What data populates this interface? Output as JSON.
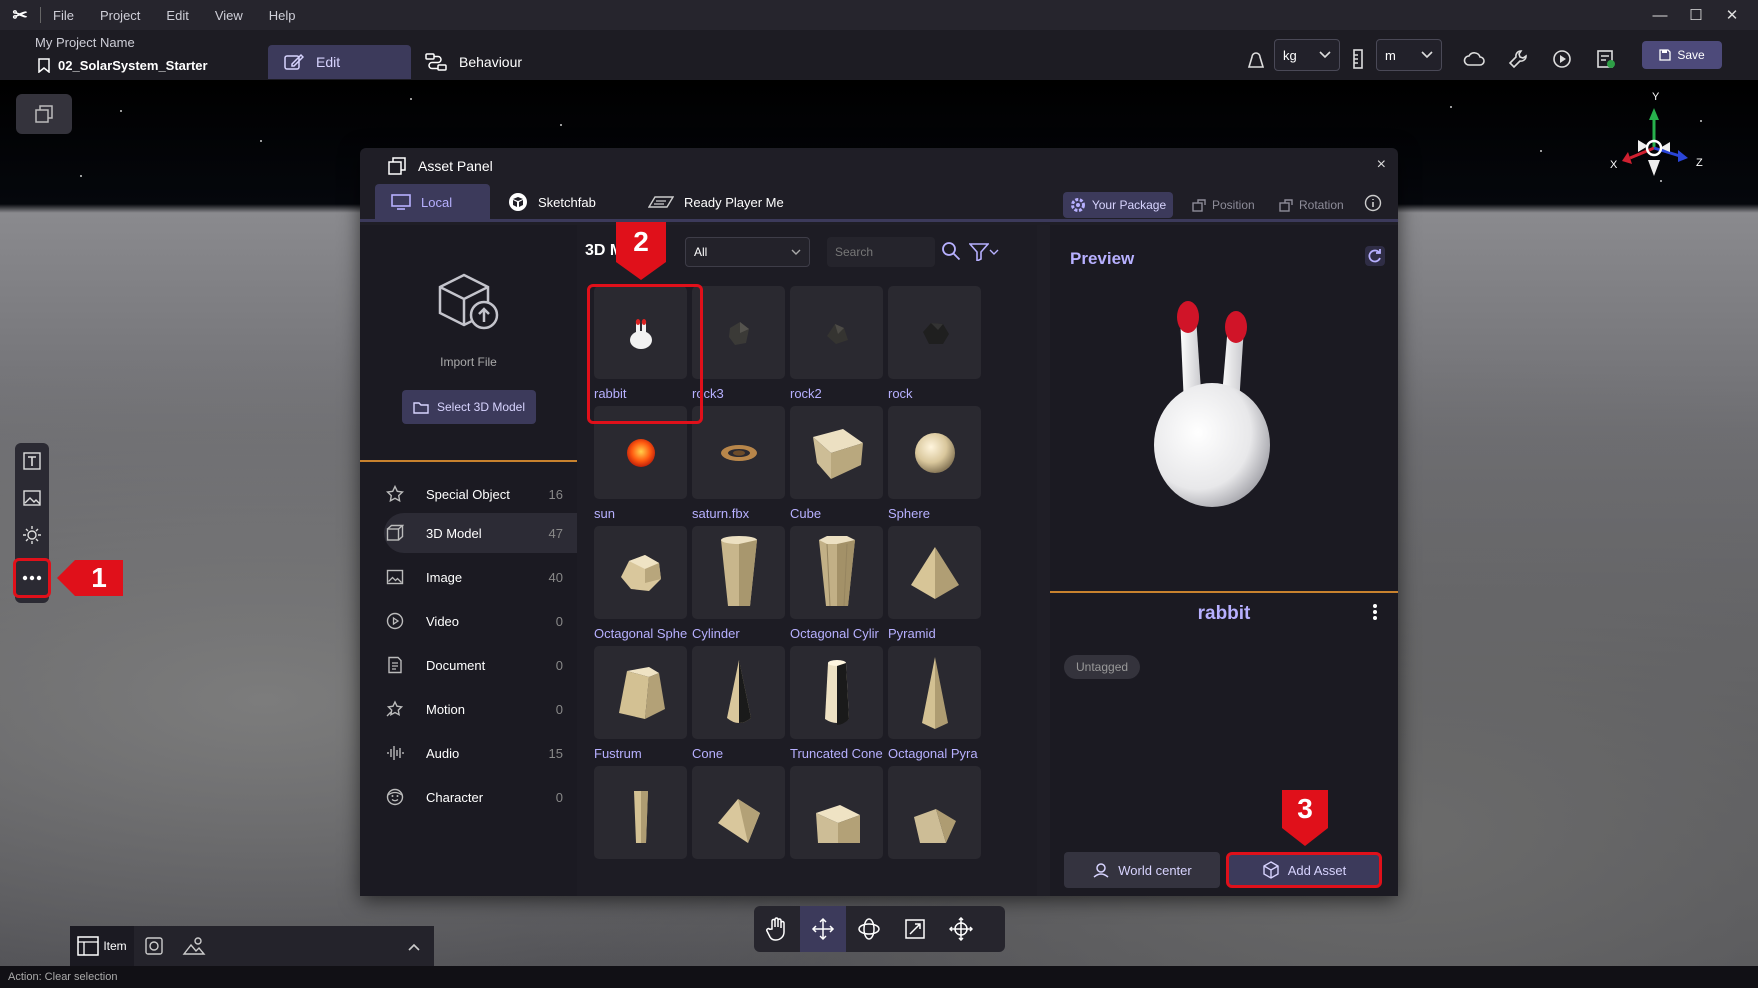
{
  "menu": {
    "logo": "✂",
    "items": [
      "File",
      "Project",
      "Edit",
      "View",
      "Help"
    ]
  },
  "window_controls": [
    "—",
    "☐",
    "✕"
  ],
  "project": {
    "name": "My Project Name",
    "scene": "02_SolarSystem_Starter",
    "tabs": {
      "edit": "Edit",
      "behaviour": "Behaviour"
    }
  },
  "toolbar": {
    "mass_unit": "kg",
    "length_unit": "m",
    "save_label": "Save"
  },
  "asset_panel": {
    "title": "Asset Panel",
    "close": "×",
    "tabs": {
      "local": "Local",
      "sketchfab": "Sketchfab",
      "rpm": "Ready Player Me"
    },
    "package_label": "Your Package",
    "position_label": "Position",
    "rotation_label": "Rotation",
    "import_label": "Import File",
    "select_model_label": "Select 3D Model",
    "categories": [
      {
        "name": "Special Object",
        "count": "16"
      },
      {
        "name": "3D Model",
        "count": "47"
      },
      {
        "name": "Image",
        "count": "40"
      },
      {
        "name": "Video",
        "count": "0"
      },
      {
        "name": "Document",
        "count": "0"
      },
      {
        "name": "Motion",
        "count": "0"
      },
      {
        "name": "Audio",
        "count": "15"
      },
      {
        "name": "Character",
        "count": "0"
      }
    ],
    "grid_title": "3D M",
    "type_filter": "All",
    "search_placeholder": "Search",
    "assets": [
      {
        "name": "rabbit"
      },
      {
        "name": "rock3"
      },
      {
        "name": "rock2"
      },
      {
        "name": "rock"
      },
      {
        "name": "sun"
      },
      {
        "name": "saturn.fbx"
      },
      {
        "name": "Cube"
      },
      {
        "name": "Sphere"
      },
      {
        "name": "Octagonal Sphe"
      },
      {
        "name": "Cylinder"
      },
      {
        "name": "Octagonal Cylir"
      },
      {
        "name": "Pyramid"
      },
      {
        "name": "Fustrum"
      },
      {
        "name": "Cone"
      },
      {
        "name": "Truncated Cone"
      },
      {
        "name": "Octagonal Pyra"
      },
      {
        "name": ""
      },
      {
        "name": ""
      },
      {
        "name": ""
      },
      {
        "name": ""
      }
    ],
    "preview": {
      "title": "Preview",
      "asset_name": "rabbit",
      "tag": "Untagged",
      "world_center_label": "World center",
      "add_asset_label": "Add Asset"
    }
  },
  "callouts": {
    "one": "1",
    "two": "2",
    "three": "3"
  },
  "gizmo": {
    "x": "X",
    "y": "Y",
    "z": "Z"
  },
  "bottom": {
    "item_label": "Item"
  },
  "status": "Action: Clear selection",
  "colors": {
    "accent": "#b7b0ff",
    "highlight": "#e0101a",
    "panel": "#1f1e26",
    "divider": "#c8822e"
  }
}
